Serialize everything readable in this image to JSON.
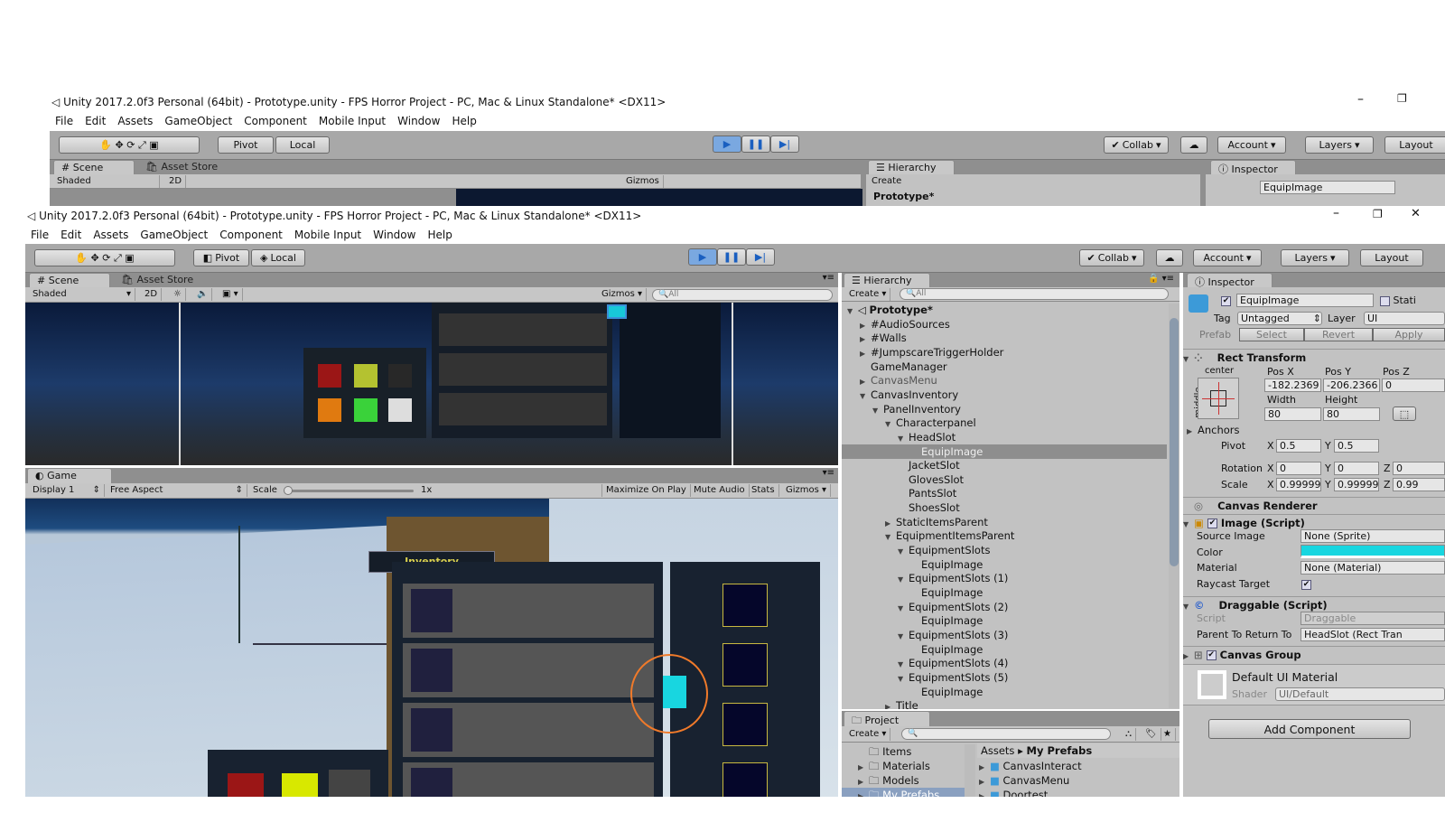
{
  "window": {
    "title": "Unity 2017.2.0f3 Personal (64bit) - Prototype.unity - FPS Horror Project - PC, Mac & Linux Standalone* <DX11>"
  },
  "menu": [
    "File",
    "Edit",
    "Assets",
    "GameObject",
    "Component",
    "Mobile Input",
    "Window",
    "Help"
  ],
  "toolbar": {
    "pivot": "Pivot",
    "local": "Local",
    "collab": "Collab",
    "account": "Account",
    "layers": "Layers",
    "layout": "Layout"
  },
  "scene": {
    "tab": "Scene",
    "asset_store": "Asset Store",
    "shading": "Shaded",
    "mode2d": "2D",
    "gizmos": "Gizmos",
    "search": "All"
  },
  "game": {
    "tab": "Game",
    "display": "Display 1",
    "aspect": "Free Aspect",
    "scale_label": "Scale",
    "scale_value": "1x",
    "maximize": "Maximize On Play",
    "mute": "Mute Audio",
    "stats": "Stats",
    "gizmos": "Gizmos",
    "inventory_title": "Inventory",
    "highlight_color": "#18d6e0"
  },
  "hierarchy": {
    "tab": "Hierarchy",
    "create": "Create",
    "search": "All",
    "items": [
      {
        "label": "Prototype*",
        "level": 0,
        "arrow": "open",
        "bold": true
      },
      {
        "label": "#AudioSources",
        "level": 1,
        "arrow": "closed"
      },
      {
        "label": "#Walls",
        "level": 1,
        "arrow": "closed"
      },
      {
        "label": "#JumpscareTriggerHolder",
        "level": 1,
        "arrow": "closed"
      },
      {
        "label": "GameManager",
        "level": 1,
        "arrow": "none"
      },
      {
        "label": "CanvasMenu",
        "level": 1,
        "arrow": "closed",
        "dim": true
      },
      {
        "label": "CanvasInventory",
        "level": 1,
        "arrow": "open"
      },
      {
        "label": "PanelInventory",
        "level": 2,
        "arrow": "open"
      },
      {
        "label": "Characterpanel",
        "level": 3,
        "arrow": "open"
      },
      {
        "label": "HeadSlot",
        "level": 4,
        "arrow": "open"
      },
      {
        "label": "EquipImage",
        "level": 5,
        "arrow": "none",
        "selected": true
      },
      {
        "label": "JacketSlot",
        "level": 4,
        "arrow": "none"
      },
      {
        "label": "GlovesSlot",
        "level": 4,
        "arrow": "none"
      },
      {
        "label": "PantsSlot",
        "level": 4,
        "arrow": "none"
      },
      {
        "label": "ShoesSlot",
        "level": 4,
        "arrow": "none"
      },
      {
        "label": "StaticItemsParent",
        "level": 3,
        "arrow": "closed"
      },
      {
        "label": "EquipmentItemsParent",
        "level": 3,
        "arrow": "open"
      },
      {
        "label": "EquipmentSlots",
        "level": 4,
        "arrow": "open"
      },
      {
        "label": "EquipImage",
        "level": 5,
        "arrow": "none"
      },
      {
        "label": "EquipmentSlots (1)",
        "level": 4,
        "arrow": "open"
      },
      {
        "label": "EquipImage",
        "level": 5,
        "arrow": "none"
      },
      {
        "label": "EquipmentSlots (2)",
        "level": 4,
        "arrow": "open"
      },
      {
        "label": "EquipImage",
        "level": 5,
        "arrow": "none"
      },
      {
        "label": "EquipmentSlots (3)",
        "level": 4,
        "arrow": "open"
      },
      {
        "label": "EquipImage",
        "level": 5,
        "arrow": "none"
      },
      {
        "label": "EquipmentSlots (4)",
        "level": 4,
        "arrow": "open"
      },
      {
        "label": "EquipmentSlots (5)",
        "level": 4,
        "arrow": "open"
      },
      {
        "label": "EquipImage",
        "level": 5,
        "arrow": "none"
      },
      {
        "label": "Title",
        "level": 3,
        "arrow": "closed"
      }
    ]
  },
  "project": {
    "tab": "Project",
    "create": "Create",
    "folders": [
      "Items",
      "Materials",
      "Models",
      "My Prefabs"
    ],
    "breadcrumb_root": "Assets",
    "breadcrumb_current": "My Prefabs",
    "assets": [
      "CanvasInteract",
      "CanvasMenu",
      "Doortest"
    ]
  },
  "inspector": {
    "tab": "Inspector",
    "name": "EquipImage",
    "static": "Stati",
    "tag_label": "Tag",
    "tag": "Untagged",
    "layer_label": "Layer",
    "layer": "UI",
    "prefab": "Prefab",
    "select": "Select",
    "revert": "Revert",
    "apply": "Apply",
    "rect": {
      "title": "Rect Transform",
      "anchor_h": "center",
      "anchor_v": "middle",
      "posx_label": "Pos X",
      "posy_label": "Pos Y",
      "posz_label": "Pos Z",
      "posx": "-182.2369",
      "posy": "-206.2366",
      "posz": "0",
      "width_label": "Width",
      "height_label": "Height",
      "width": "80",
      "height": "80",
      "anchors": "Anchors",
      "pivot": "Pivot",
      "pivot_x": "0.5",
      "pivot_y": "0.5",
      "rotation": "Rotation",
      "rot_x": "0",
      "rot_y": "0",
      "rot_z": "0",
      "scale": "Scale",
      "scale_x": "0.99999",
      "scale_y": "0.99999",
      "scale_z": "0.99",
      "x": "X",
      "y": "Y",
      "z": "Z"
    },
    "canvas_renderer": "Canvas Renderer",
    "image": {
      "title": "Image (Script)",
      "source_label": "Source Image",
      "source": "None (Sprite)",
      "color_label": "Color",
      "color": "#18d6e0",
      "material_label": "Material",
      "material": "None (Material)",
      "raycast_label": "Raycast Target",
      "raycast": true
    },
    "draggable": {
      "title": "Draggable (Script)",
      "script_label": "Script",
      "script": "Draggable",
      "parent_label": "Parent To Return To",
      "parent": "HeadSlot (Rect Tran"
    },
    "canvas_group": "Canvas Group",
    "material": {
      "name": "Default UI Material",
      "shader_label": "Shader",
      "shader": "UI/Default"
    },
    "add_component": "Add Component"
  }
}
